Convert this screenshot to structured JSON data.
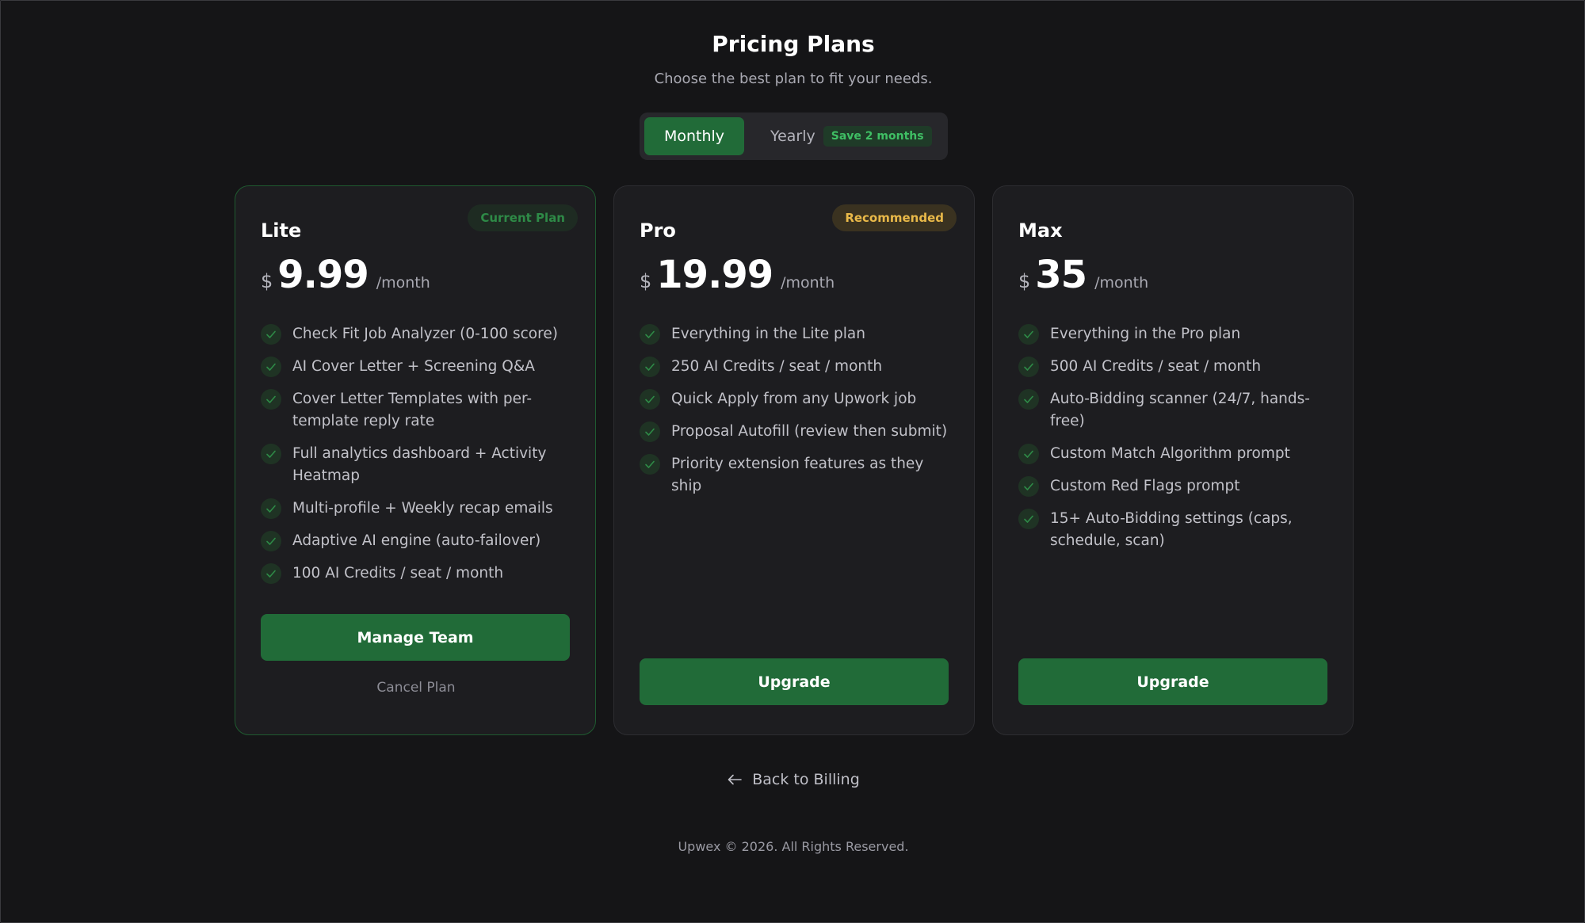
{
  "header": {
    "title": "Pricing Plans",
    "subtitle": "Choose the best plan to fit your needs."
  },
  "billing_toggle": {
    "monthly_label": "Monthly",
    "yearly_label": "Yearly",
    "yearly_badge": "Save 2 months",
    "selected": "Monthly"
  },
  "plans": [
    {
      "name": "Lite",
      "badge": "Current Plan",
      "currency": "$",
      "price": "9.99",
      "period": "/month",
      "features": [
        "Check Fit Job Analyzer (0-100 score)",
        "AI Cover Letter + Screening Q&A",
        "Cover Letter Templates with per-template reply rate",
        "Full analytics dashboard + Activity Heatmap",
        "Multi-profile + Weekly recap emails",
        "Adaptive AI engine (auto-failover)",
        "100 AI Credits / seat / month"
      ],
      "primary_button": "Manage Team",
      "secondary_link": "Cancel Plan"
    },
    {
      "name": "Pro",
      "badge": "Recommended",
      "currency": "$",
      "price": "19.99",
      "period": "/month",
      "features": [
        "Everything in the Lite plan",
        "250 AI Credits / seat / month",
        "Quick Apply from any Upwork job",
        "Proposal Autofill (review then submit)",
        "Priority extension features as they ship"
      ],
      "primary_button": "Upgrade"
    },
    {
      "name": "Max",
      "currency": "$",
      "price": "35",
      "period": "/month",
      "features": [
        "Everything in the Pro plan",
        "500 AI Credits / seat / month",
        "Auto-Bidding scanner (24/7, hands-free)",
        "Custom Match Algorithm prompt",
        "Custom Red Flags prompt",
        "15+ Auto-Bidding settings (caps, schedule, scan)"
      ],
      "primary_button": "Upgrade"
    }
  ],
  "back_link": "Back to Billing",
  "footer": "Upwex © 2026. All Rights Reserved.",
  "colors": {
    "background": "#151517",
    "card": "#1d1d20",
    "accent_green": "#216b38",
    "badge_green": "#2e8a47",
    "badge_gold": "#e9b949"
  }
}
